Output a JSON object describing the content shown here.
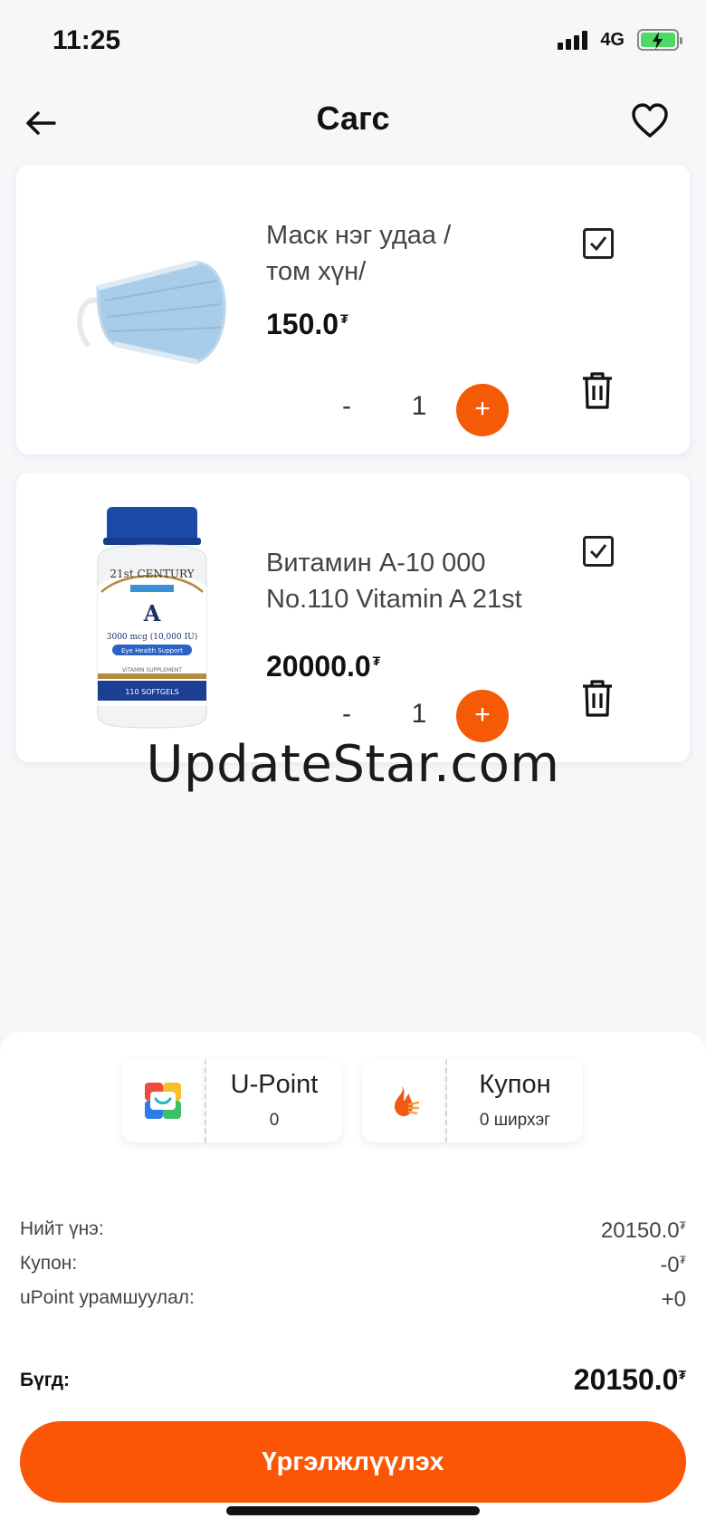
{
  "status_bar": {
    "time": "11:25",
    "network": "4G"
  },
  "header": {
    "title": "Сагс"
  },
  "cart_items": [
    {
      "name_line1": "Маск нэг удаа /",
      "name_line2": "том хүн/",
      "price": "150.0",
      "currency_symbol": "₮",
      "quantity": "1",
      "minus_label": "-",
      "plus_label": "+"
    },
    {
      "name_line1": "Витамин А-10 000",
      "name_line2": "No.110 Vitamin A 21st",
      "price": "20000.0",
      "currency_symbol": "₮",
      "quantity": "1",
      "minus_label": "-",
      "plus_label": "+",
      "bottle_brand": "21st CENTURY",
      "bottle_letter": "A",
      "bottle_dose": "3000 mcg (10,000 IU)",
      "bottle_support": "Eye Health Support",
      "bottle_type": "VITAMIN SUPPLEMENT",
      "bottle_count": "110 SOFTGELS"
    }
  ],
  "watermark": "UpdateStar.com",
  "promo": {
    "upoint": {
      "title": "U-Point",
      "value": "0"
    },
    "coupon": {
      "title": "Купон",
      "value": "0 ширхэг"
    }
  },
  "summary": {
    "subtotal_label": "Нийт үнэ:",
    "subtotal_value": "20150.0",
    "coupon_label": "Купон:",
    "coupon_value": "-0",
    "upoint_label": "uPoint урамшуулал:",
    "upoint_value": "+0",
    "total_label": "Бүгд:",
    "total_value": "20150.0",
    "currency_symbol": "₮"
  },
  "actions": {
    "continue_label": "Үргэлжлүүлэх"
  },
  "colors": {
    "accent": "#f55a07",
    "button": "#fb5605",
    "battery": "#4cd964"
  }
}
